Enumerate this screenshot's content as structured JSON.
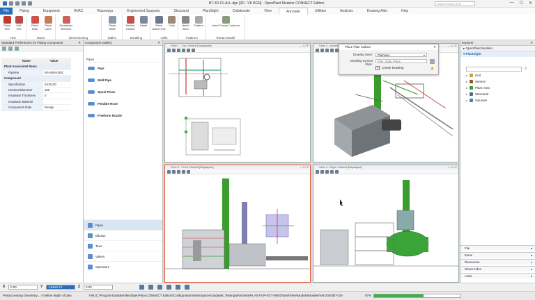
{
  "window": {
    "title": "BT-3D-01-ALL.dgn [3D - V8 DGN] - OpenPlant Modeler CONNECT Edition",
    "search_placeholder": "Search Ribbon (F4)",
    "min": "—",
    "max": "☐",
    "close": "✕"
  },
  "tabs": {
    "file": "File",
    "items": [
      "Piping",
      "Equipment",
      "HVAC",
      "Raceways",
      "Engineered Supports",
      "Structural",
      "PlantSight",
      "Collaborate",
      "View",
      "Annotate",
      "Utilities",
      "Analysis",
      "Drawing Aids",
      "Help"
    ],
    "active": "Annotate"
  },
  "ribbon": {
    "groups": [
      {
        "label": "Text",
        "buttons": [
          "Place Text",
          "Edit Text"
        ]
      },
      {
        "label": "Notes",
        "buttons": [
          "Place Note",
          "Place Label"
        ]
      },
      {
        "label": "Dimensioning",
        "buttons": [
          "Dimension Element"
        ]
      },
      {
        "label": "Tables",
        "buttons": [
          "Place Table"
        ]
      },
      {
        "label": "Detailing",
        "buttons": [
          "Section Callout",
          "Detail"
        ]
      },
      {
        "label": "Cells",
        "buttons": [
          "Place Active Cell",
          "Cells"
        ]
      },
      {
        "label": "Patterns",
        "buttons": [
          "Hatch Area",
          "Pattern"
        ]
      },
      {
        "label": "Terrain Model",
        "buttons": [
          "Label Terrain Contours"
        ]
      }
    ]
  },
  "left_panel": {
    "title": "Standard Preferences for Piping Component",
    "columns": {
      "name": "Name",
      "value": "Value"
    },
    "sections": [
      {
        "name": "Plant Associated Items",
        "rows": [
          {
            "k": "Pipeline",
            "v": "00-SWS-0001"
          }
        ]
      },
      {
        "name": "Component",
        "rows": [
          {
            "k": "Specification",
            "v": "mCS150"
          },
          {
            "k": "Nominal Diameter",
            "v": "150"
          },
          {
            "k": "Insulation Thickness",
            "v": "0"
          },
          {
            "k": "Insulation Material",
            "v": ""
          },
          {
            "k": "Component State",
            "v": "Design"
          }
        ]
      }
    ]
  },
  "gallery": {
    "title": "Component Gallery",
    "section": "Pipes",
    "items": [
      "Pipe",
      "Wall Pipe",
      "Spool Piece",
      "Flexible Hose",
      "Freeform Nozzle"
    ],
    "bottom": [
      "Pipes",
      "Elbows",
      "Tees",
      "Valves",
      "Operators"
    ],
    "selected": "Pipes"
  },
  "views": [
    {
      "title": "View 1 - Top, Default [Displayset]"
    },
    {
      "title": "View 2 - Isometric, Default"
    },
    {
      "title": "View 3 - Front, Default [Displayset]"
    },
    {
      "title": "View 4 - Right, Default [Displayset]"
    }
  ],
  "dialog": {
    "title": "Place Plan Callout",
    "seed_label": "Drawing Seed:",
    "seed_value": "PlanView",
    "style_label": "Detailing Symbol Style:",
    "style_value": "Plan_Style_Plans",
    "checkbox_label": "Create Drawing",
    "checkbox_checked": true
  },
  "explorer": {
    "title": "Explorer",
    "app": "OpenPlant Modeler",
    "plantsight": "PlantSight",
    "search_placeholder": "",
    "tree": [
      {
        "label": "Unit",
        "color": "#c9a227"
      },
      {
        "label": "Service",
        "color": "#8a5a2b"
      },
      {
        "label": "Plant Area",
        "color": "#3a9a3a"
      },
      {
        "label": "Structural",
        "color": "#5a6a7a"
      },
      {
        "label": "Volumes",
        "color": "#4a7ac0"
      }
    ],
    "sections": [
      "File",
      "Items",
      "Resources",
      "Sheet Index",
      "Links"
    ]
  },
  "status": {
    "x_label": "X",
    "x_value": "0.00",
    "y_label": "Y",
    "y_value": "-15910.74",
    "z_label": "Z",
    "z_value": "0.00",
    "message": "Preprocessing Geometry... > Define depth of plan",
    "file": "File [C:\\ProgramData\\Bentley\\OpenPlant CONNECT Edition\\Configuration\\WorkSpaces\\Update8_Testing\\WorkSets\\PLANT-OP-EXT-M002\\WorkFiles\\Models\\Modeler\\V8-2020\\BT-3D-",
    "progress_text": "57%",
    "progress": 0.57
  }
}
